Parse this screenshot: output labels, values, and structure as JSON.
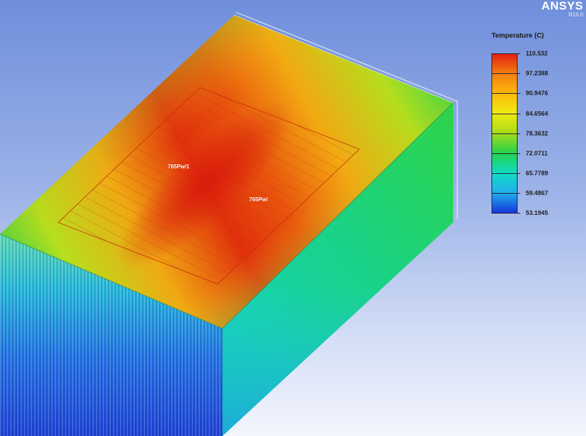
{
  "app": {
    "brand": "ANSYS",
    "version": "R16.0"
  },
  "legend": {
    "title": "Temperature (C)",
    "values": [
      "110.532",
      "97.2388",
      "90.9476",
      "84.6564",
      "78.3632",
      "72.0711",
      "65.7789",
      "59.4867",
      "53.1945"
    ],
    "colors": [
      "#e32010",
      "#f47d10",
      "#fbb90b",
      "#f0ea10",
      "#a6dc1a",
      "#26d24a",
      "#11dcc4",
      "#21b0ec",
      "#1538dc"
    ]
  },
  "probes": [
    {
      "label": "765Pw/1"
    },
    {
      "label": "765Pw/"
    }
  ]
}
